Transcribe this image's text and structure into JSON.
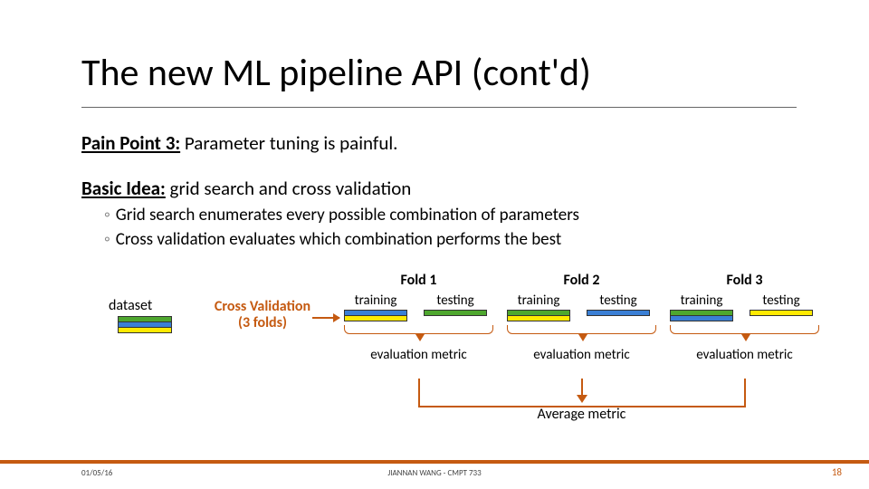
{
  "title": "The new ML pipeline API  (cont'd)",
  "pain": {
    "label": "Pain Point 3:",
    "text": " Parameter tuning is painful."
  },
  "idea": {
    "label": "Basic Idea:",
    "text": " grid search and cross validation"
  },
  "bullets": {
    "b1": "Grid search enumerates every possible combination of parameters",
    "b2": "Cross validation evaluates which combination performs the best"
  },
  "diagram": {
    "dataset": "dataset",
    "cv1": "Cross Validation",
    "cv2": "(3 folds)",
    "training": "training",
    "testing": "testing",
    "fold1": "Fold  1",
    "fold2": "Fold  2",
    "fold3": "Fold  3",
    "eval": "evaluation metric",
    "average": "Average  metric"
  },
  "footer": {
    "date": "01/05/16",
    "mid": "JIANNAN WANG - CMPT 733",
    "page": "18"
  }
}
